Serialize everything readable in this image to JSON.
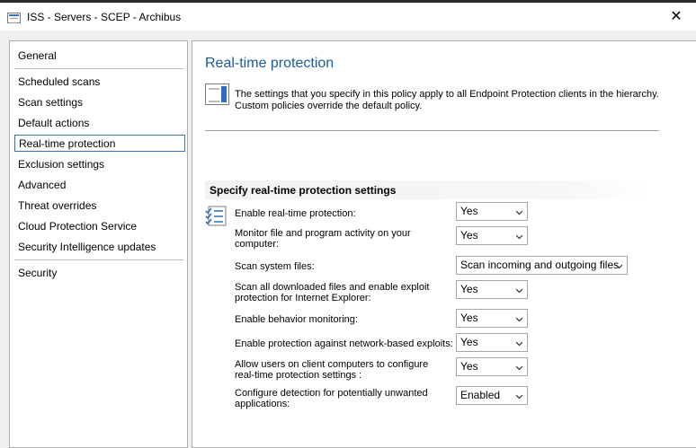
{
  "window": {
    "title": "ISS - Servers - SCEP - Archibus",
    "close_glyph": "✕"
  },
  "nav": {
    "items": [
      {
        "label": "General"
      },
      {
        "label": "Scheduled scans"
      },
      {
        "label": "Scan settings"
      },
      {
        "label": "Default actions"
      },
      {
        "label": "Real-time protection",
        "selected": true
      },
      {
        "label": "Exclusion settings"
      },
      {
        "label": "Advanced"
      },
      {
        "label": "Threat overrides"
      },
      {
        "label": "Cloud Protection Service"
      },
      {
        "label": "Security Intelligence updates"
      },
      {
        "label": "Security"
      }
    ]
  },
  "main": {
    "title": "Real-time protection",
    "info_line1": "The settings that you specify in this policy apply to all Endpoint Protection clients in the hierarchy.",
    "info_line2": "Custom policies override the default policy.",
    "section_title": "Specify real-time protection settings",
    "settings": [
      {
        "label1": "Enable real-time protection:",
        "label2": "",
        "value": "Yes"
      },
      {
        "label1": "Monitor file and program activity on your",
        "label2": "computer:",
        "value": "Yes"
      },
      {
        "label1": "Scan system files:",
        "label2": "",
        "value": "Scan incoming and outgoing files"
      },
      {
        "label1": "Scan all downloaded files and enable exploit",
        "label2": "protection for Internet Explorer:",
        "value": "Yes"
      },
      {
        "label1": "Enable behavior monitoring:",
        "label2": "",
        "value": "Yes"
      },
      {
        "label1": "Enable protection against network-based exploits:",
        "label2": "",
        "value": "Yes"
      },
      {
        "label1": "Allow users on client computers to configure",
        "label2": "real-time protection settings :",
        "value": "Yes"
      },
      {
        "label1": "Configure detection for potentially unwanted",
        "label2": "applications:",
        "value": "Enabled"
      }
    ]
  },
  "icons": {
    "app": "window-icon",
    "info": "policy-document-icon",
    "settings": "checklist-icon",
    "dropdown": "chevron-down-icon"
  },
  "colors": {
    "title_blue": "#1a5a9c",
    "selection_border": "#3c6fb0"
  }
}
